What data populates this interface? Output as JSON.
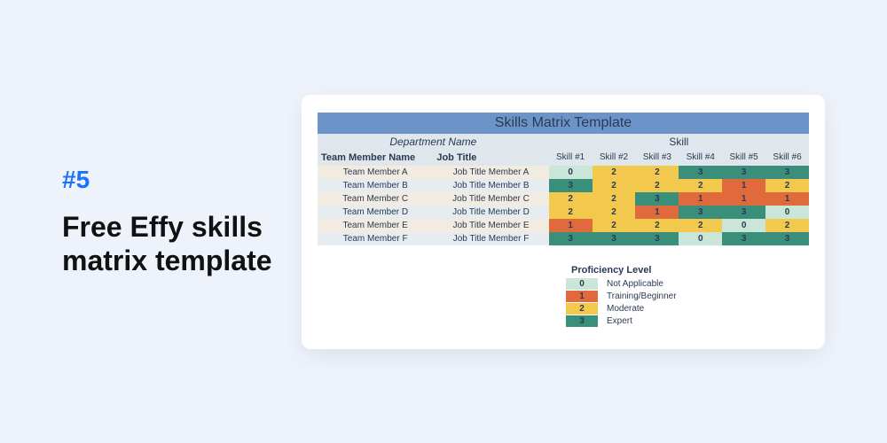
{
  "tag": "#5",
  "headline": "Free Effy skills matrix template",
  "matrix": {
    "title": "Skills Matrix Template",
    "department_label": "Department Name",
    "skill_group_label": "Skill",
    "name_header": "Team Member Name",
    "job_header": "Job Title",
    "skills": [
      "Skill #1",
      "Skill #2",
      "Skill #3",
      "Skill #4",
      "Skill #5",
      "Skill #6"
    ],
    "rows": [
      {
        "name": "Team Member A",
        "job": "Job Title Member A",
        "vals": [
          0,
          2,
          2,
          3,
          3,
          3
        ]
      },
      {
        "name": "Team Member B",
        "job": "Job Title Member B",
        "vals": [
          3,
          2,
          2,
          2,
          1,
          2
        ]
      },
      {
        "name": "Team Member C",
        "job": "Job Title Member C",
        "vals": [
          2,
          2,
          3,
          1,
          1,
          1
        ]
      },
      {
        "name": "Team Member D",
        "job": "Job Title Member D",
        "vals": [
          2,
          2,
          1,
          3,
          3,
          0
        ]
      },
      {
        "name": "Team Member E",
        "job": "Job Title Member E",
        "vals": [
          1,
          2,
          2,
          2,
          0,
          2
        ]
      },
      {
        "name": "Team Member F",
        "job": "Job Title Member F",
        "vals": [
          3,
          3,
          3,
          0,
          3,
          3
        ]
      }
    ]
  },
  "legend": {
    "title": "Proficiency Level",
    "items": [
      {
        "value": 0,
        "label": "Not Applicable"
      },
      {
        "value": 1,
        "label": "Training/Beginner"
      },
      {
        "value": 2,
        "label": "Moderate"
      },
      {
        "value": 3,
        "label": "Expert"
      }
    ]
  },
  "chart_data": {
    "type": "table",
    "title": "Skills Matrix Template",
    "columns": [
      "Team Member Name",
      "Job Title",
      "Skill #1",
      "Skill #2",
      "Skill #3",
      "Skill #4",
      "Skill #5",
      "Skill #6"
    ],
    "rows": [
      [
        "Team Member A",
        "Job Title Member A",
        0,
        2,
        2,
        3,
        3,
        3
      ],
      [
        "Team Member B",
        "Job Title Member B",
        3,
        2,
        2,
        2,
        1,
        2
      ],
      [
        "Team Member C",
        "Job Title Member C",
        2,
        2,
        3,
        1,
        1,
        1
      ],
      [
        "Team Member D",
        "Job Title Member D",
        2,
        2,
        1,
        3,
        3,
        0
      ],
      [
        "Team Member E",
        "Job Title Member E",
        1,
        2,
        2,
        2,
        0,
        2
      ],
      [
        "Team Member F",
        "Job Title Member F",
        3,
        3,
        3,
        0,
        3,
        3
      ]
    ],
    "scale": {
      "0": "Not Applicable",
      "1": "Training/Beginner",
      "2": "Moderate",
      "3": "Expert"
    }
  }
}
